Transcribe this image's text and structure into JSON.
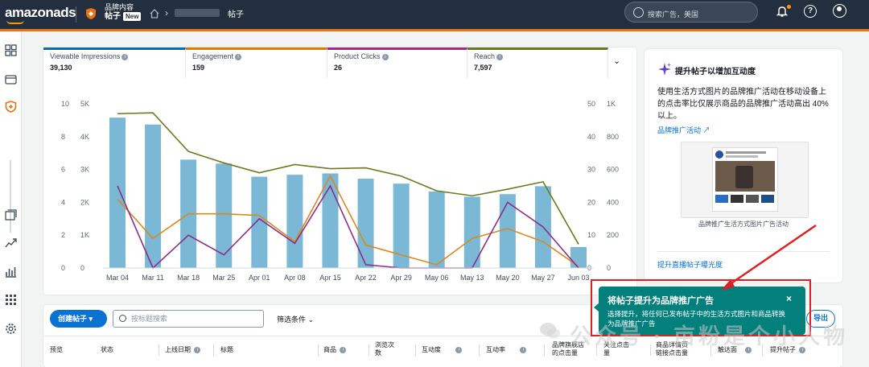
{
  "header": {
    "logo_text": "amazonads",
    "breadcrumb_parent": "品牌内容",
    "breadcrumb_current": "帖子",
    "new_badge": "New",
    "breadcrumb_leaf": "帖子",
    "search_placeholder": "搜索广告，美国"
  },
  "metrics": [
    {
      "label": "Viewable Impressions",
      "value": "39,130",
      "color": "#0a6fa8"
    },
    {
      "label": "Engagement",
      "value": "159",
      "color": "#e07b0a"
    },
    {
      "label": "Product Clicks",
      "value": "26",
      "color": "#9c2d8f"
    },
    {
      "label": "Reach",
      "value": "7,597",
      "color": "#6b7a1e"
    }
  ],
  "chart_data": {
    "type": "bar",
    "categories": [
      "Mar 04",
      "Mar 11",
      "Mar 18",
      "Mar 25",
      "Apr 01",
      "Apr 08",
      "Apr 15",
      "Apr 22",
      "Apr 29",
      "May 06",
      "May 13",
      "May 20",
      "May 27",
      "Jun 03"
    ],
    "left_axis_1_ticks": [
      "10",
      "8",
      "6",
      "4",
      "2",
      "0"
    ],
    "left_axis_2_ticks": [
      "5K",
      "4K",
      "3K",
      "2K",
      "1K",
      "0"
    ],
    "right_axis_1_ticks": [
      "50",
      "40",
      "30",
      "20",
      "10",
      "0"
    ],
    "right_axis_2_ticks": [
      "1K",
      "800",
      "600",
      "400",
      "200",
      "0"
    ],
    "series": [
      {
        "name": "Viewable Impressions",
        "type": "bar",
        "axis": "5K",
        "color": "#7ab8d6",
        "values": [
          4580,
          4370,
          3300,
          3180,
          2780,
          2840,
          2880,
          2720,
          2570,
          2330,
          2170,
          2250,
          2490,
          640
        ]
      },
      {
        "name": "Engagement",
        "type": "line",
        "axis": "50",
        "color": "#d88a1e",
        "values": [
          21,
          9,
          16.5,
          16.5,
          16,
          8,
          28,
          7,
          4,
          1,
          9,
          12,
          8,
          0.5
        ]
      },
      {
        "name": "Product Clicks",
        "type": "line",
        "axis": "10",
        "color": "#8b2d8b",
        "values": [
          5,
          0,
          2,
          0.8,
          3,
          1.5,
          5,
          0.2,
          0,
          0,
          0,
          4,
          2.5,
          0
        ]
      },
      {
        "name": "Reach",
        "type": "line",
        "axis": "1K",
        "color": "#6e7a1e",
        "values": [
          940,
          945,
          710,
          640,
          580,
          630,
          605,
          610,
          560,
          470,
          440,
          480,
          525,
          145
        ]
      }
    ]
  },
  "side": {
    "title": "提升帖子以增加互动度",
    "body": "使用生活方式图片的品牌推广活动在移动设备上的点击率比仅展示商品的品牌推广活动高出 40% 以上。",
    "link1": "品牌推广活动",
    "thumb_caption": "品牌推广生活方式图片广告活动",
    "link2": "提升直播帖子曝光度"
  },
  "table": {
    "create_label": "创建帖子",
    "search_placeholder": "按标题搜索",
    "filter_label": "筛选条件",
    "export_label": "导出",
    "columns": [
      "预览",
      "状态",
      "上线日期",
      "标题",
      "商品",
      "浏览次数",
      "互动度",
      "互动率",
      "品牌旗舰店的点击量",
      "关注点击量",
      "商品详情页链接点击量",
      "触达面",
      "提升帖子"
    ]
  },
  "popup": {
    "title": "将帖子提升为品牌推广广告",
    "body": "选择提升，将任何已发布帖子中的生活方式图片和商品转换为品牌推广广告",
    "close": "×"
  },
  "watermark": "公众号 · 亩粉是个小人物"
}
